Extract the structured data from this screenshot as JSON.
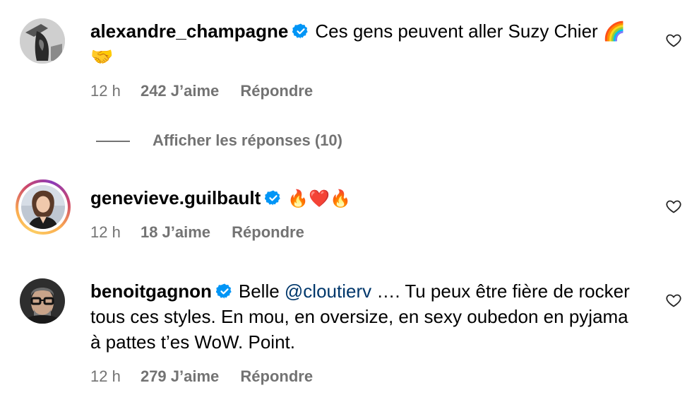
{
  "comments": [
    {
      "username": "alexandre_champagne",
      "text": "Ces gens peuvent aller Suzy Chier 🌈🤝",
      "time": "12 h",
      "likes": "242 J’aime",
      "reply": "Répondre",
      "view_replies": "Afficher les réponses (10)"
    },
    {
      "username": "genevieve.guilbault",
      "text": "🔥❤️🔥",
      "time": "12 h",
      "likes": "18 J’aime",
      "reply": "Répondre"
    },
    {
      "username": "benoitgagnon",
      "text_before": "Belle ",
      "mention": "@cloutierv",
      "text_after": " …. Tu peux être fière de rocker tous ces styles. En mou, en oversize, en sexy oubedon en pyjama à pattes t’es WoW. Point.",
      "time": "12 h",
      "likes": "279 J’aime",
      "reply": "Répondre"
    }
  ],
  "colors": {
    "text": "#000000",
    "secondary": "#737373",
    "verified": "#0095f6",
    "mention": "#00376b"
  },
  "icons": [
    "verified-badge-icon",
    "heart-outline-icon"
  ]
}
